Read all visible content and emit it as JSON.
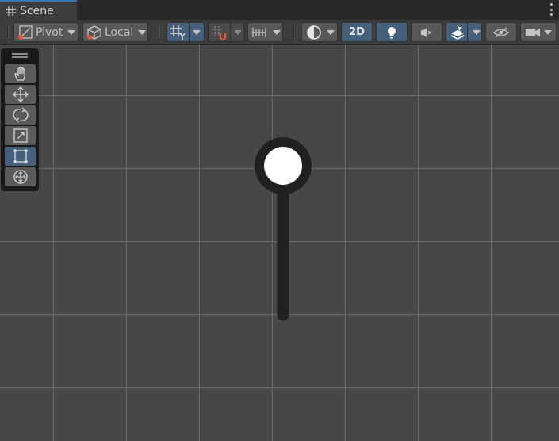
{
  "tab": {
    "title": "Scene",
    "icon": "grid-hash-icon"
  },
  "toolbar": {
    "pivot_label": "Pivot",
    "local_label": "Local",
    "mode_2d_label": "2D",
    "icons": [
      "pivot-icon",
      "local-cube-icon",
      "grid-snap-icon",
      "snap-increment-icon",
      "ruler-icon",
      "shading-mode-icon",
      "lighting-bulb-icon",
      "audio-mute-icon",
      "effects-layers-icon",
      "visibility-eye-icon",
      "camera-icon",
      "kebab-menu-icon"
    ]
  },
  "tools": {
    "items": [
      "hand-tool",
      "move-tool",
      "rotate-tool",
      "scale-tool",
      "rect-tool",
      "transform-tool"
    ],
    "selected": "rect-tool"
  },
  "colors": {
    "viewport_bg": "#474747",
    "grid_line": "#6a6a6a",
    "toolbar_bg": "#3c3c3c",
    "button_bg": "#585858",
    "active_blue": "#46607c",
    "tab_accent": "#3a79bb",
    "sprite_dark": "#202020",
    "sprite_light": "#ffffff"
  }
}
